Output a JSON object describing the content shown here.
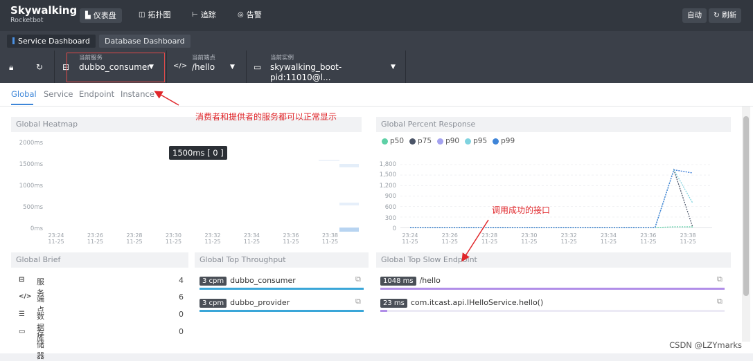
{
  "brand": {
    "name": "Skywalking",
    "sub": "Rocketbot"
  },
  "nav": [
    {
      "label": "仪表盘",
      "icon": "dashboard-icon",
      "active": true
    },
    {
      "label": "拓扑图",
      "icon": "topology-icon",
      "active": false
    },
    {
      "label": "追踪",
      "icon": "trace-icon",
      "active": false
    },
    {
      "label": "告警",
      "icon": "alarm-icon",
      "active": false
    }
  ],
  "top_buttons": {
    "auto": "自动",
    "refresh": "刷新"
  },
  "dashboards": [
    {
      "label": "Service Dashboard",
      "active": true
    },
    {
      "label": "Database Dashboard",
      "active": false
    }
  ],
  "selectors": {
    "service": {
      "label": "当前服务",
      "value": "dubbo_consumer"
    },
    "endpoint": {
      "label": "当前端点",
      "value": "/hello"
    },
    "instance": {
      "label": "当前实例",
      "value": "skywalking_boot-pid:11010@l..."
    }
  },
  "subtabs": [
    {
      "label": "Global",
      "active": true
    },
    {
      "label": "Service",
      "active": false
    },
    {
      "label": "Endpoint",
      "active": false
    },
    {
      "label": "Instance",
      "active": false
    }
  ],
  "heatmap": {
    "title": "Global Heatmap",
    "tooltip": "1500ms [ 0 ]",
    "y_labels": [
      "2000ms",
      "1500ms",
      "1000ms",
      "500ms",
      "0ms"
    ]
  },
  "x_ticks": [
    {
      "time": "23:24",
      "date": "11-25"
    },
    {
      "time": "23:26",
      "date": "11-25"
    },
    {
      "time": "23:28",
      "date": "11-25"
    },
    {
      "time": "23:30",
      "date": "11-25"
    },
    {
      "time": "23:32",
      "date": "11-25"
    },
    {
      "time": "23:34",
      "date": "11-25"
    },
    {
      "time": "23:36",
      "date": "11-25"
    },
    {
      "time": "23:38",
      "date": "11-25"
    }
  ],
  "percent": {
    "title": "Global Percent Response",
    "legend": [
      {
        "name": "p50",
        "color": "#5ed0a6"
      },
      {
        "name": "p75",
        "color": "#4b5568"
      },
      {
        "name": "p90",
        "color": "#a4a2f0"
      },
      {
        "name": "p95",
        "color": "#7fd3df"
      },
      {
        "name": "p99",
        "color": "#3f85d8"
      }
    ],
    "y_labels": [
      "1,800",
      "1,500",
      "1,200",
      "900",
      "600",
      "300",
      "0"
    ]
  },
  "chart_data": {
    "type": "line",
    "title": "Global Percent Response",
    "x": [
      "23:24",
      "23:25",
      "23:26",
      "23:27",
      "23:28",
      "23:29",
      "23:30",
      "23:31",
      "23:32",
      "23:33",
      "23:34",
      "23:35",
      "23:36",
      "23:37",
      "23:38",
      "23:39"
    ],
    "ylim": [
      0,
      1800
    ],
    "series": [
      {
        "name": "p50",
        "color": "#5ed0a6",
        "values": [
          0,
          0,
          0,
          0,
          0,
          0,
          0,
          0,
          0,
          0,
          0,
          0,
          0,
          0,
          20,
          20
        ]
      },
      {
        "name": "p75",
        "color": "#4b5568",
        "values": [
          0,
          0,
          0,
          0,
          0,
          0,
          0,
          0,
          0,
          0,
          0,
          0,
          0,
          0,
          1650,
          10
        ]
      },
      {
        "name": "p90",
        "color": "#a4a2f0",
        "values": [
          0,
          0,
          0,
          0,
          0,
          0,
          0,
          0,
          0,
          0,
          0,
          0,
          0,
          0,
          1650,
          1560
        ]
      },
      {
        "name": "p95",
        "color": "#7fd3df",
        "values": [
          0,
          0,
          0,
          0,
          0,
          0,
          0,
          0,
          0,
          0,
          0,
          0,
          0,
          0,
          1650,
          700
        ]
      },
      {
        "name": "p99",
        "color": "#3f85d8",
        "values": [
          0,
          0,
          0,
          0,
          0,
          0,
          0,
          0,
          0,
          0,
          0,
          0,
          0,
          0,
          1650,
          1560
        ]
      }
    ]
  },
  "brief": {
    "title": "Global Brief",
    "rows": [
      {
        "icon": "service-icon",
        "name": "服务",
        "value": "4"
      },
      {
        "icon": "endpoint-icon",
        "name": "端点",
        "value": "6"
      },
      {
        "icon": "database-icon",
        "name": "数据库",
        "value": "0"
      },
      {
        "icon": "storage-icon",
        "name": "存储器",
        "value": "0"
      }
    ]
  },
  "throughput": {
    "title": "Global Top Throughput",
    "rows": [
      {
        "tag": "3 cpm",
        "name": "dubbo_consumer",
        "fill": 1.0
      },
      {
        "tag": "3 cpm",
        "name": "dubbo_provider",
        "fill": 1.0
      }
    ]
  },
  "slow": {
    "title": "Global Top Slow Endpoint",
    "rows": [
      {
        "tag": "1048 ms",
        "name": "/hello",
        "fill": 1.0
      },
      {
        "tag": "23 ms",
        "name": "com.itcast.api.IHelloService.hello()",
        "fill": 0.02
      }
    ]
  },
  "annotations": {
    "a1": "消费者和提供者的服务都可以正常显示",
    "a2": "调用成功的接口"
  },
  "watermark": "CSDN @LZYmarks"
}
